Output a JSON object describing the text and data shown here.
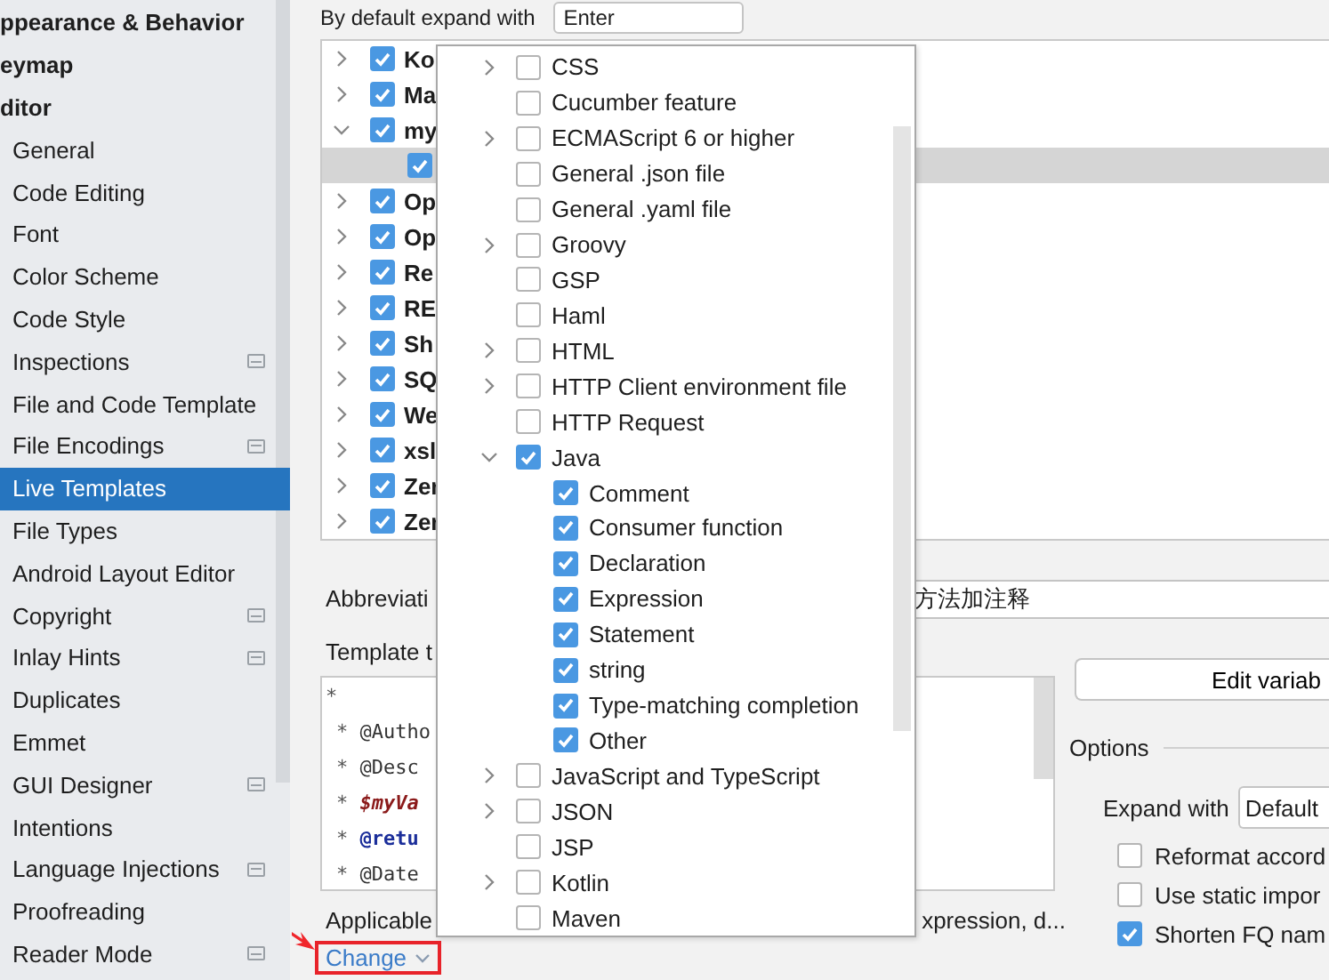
{
  "sidebar": {
    "groups": [
      {
        "label": "ppearance & Behavior"
      },
      {
        "label": "eymap"
      },
      {
        "label": "ditor"
      }
    ],
    "items": [
      {
        "label": "General",
        "selected": false,
        "has_icon": false
      },
      {
        "label": "Code Editing",
        "selected": false,
        "has_icon": false
      },
      {
        "label": "Font",
        "selected": false,
        "has_icon": false
      },
      {
        "label": "Color Scheme",
        "selected": false,
        "has_icon": false
      },
      {
        "label": "Code Style",
        "selected": false,
        "has_icon": false
      },
      {
        "label": "Inspections",
        "selected": false,
        "has_icon": true
      },
      {
        "label": "File and Code Template",
        "selected": false,
        "has_icon": false
      },
      {
        "label": "File Encodings",
        "selected": false,
        "has_icon": true
      },
      {
        "label": "Live Templates",
        "selected": true,
        "has_icon": false
      },
      {
        "label": "File Types",
        "selected": false,
        "has_icon": false
      },
      {
        "label": "Android Layout Editor",
        "selected": false,
        "has_icon": false
      },
      {
        "label": "Copyright",
        "selected": false,
        "has_icon": true
      },
      {
        "label": "Inlay Hints",
        "selected": false,
        "has_icon": true
      },
      {
        "label": "Duplicates",
        "selected": false,
        "has_icon": false
      },
      {
        "label": "Emmet",
        "selected": false,
        "has_icon": false
      },
      {
        "label": "GUI Designer",
        "selected": false,
        "has_icon": true
      },
      {
        "label": "Intentions",
        "selected": false,
        "has_icon": false
      },
      {
        "label": "Language Injections",
        "selected": false,
        "has_icon": true
      },
      {
        "label": "Proofreading",
        "selected": false,
        "has_icon": false
      },
      {
        "label": "Reader Mode",
        "selected": false,
        "has_icon": true
      }
    ]
  },
  "expand_default": {
    "label": "By default expand with",
    "value": "Enter"
  },
  "template_groups": [
    {
      "name": "Ko",
      "checked": true,
      "expanded": false,
      "selected": false
    },
    {
      "name": "Ma",
      "checked": true,
      "expanded": false,
      "selected": false
    },
    {
      "name": "my",
      "checked": true,
      "expanded": true,
      "selected": false,
      "children": [
        {
          "checked": true,
          "selected": true
        }
      ]
    },
    {
      "name": "Op",
      "checked": true,
      "expanded": false,
      "selected": false
    },
    {
      "name": "Op",
      "checked": true,
      "expanded": false,
      "selected": false
    },
    {
      "name": "Re",
      "checked": true,
      "expanded": false,
      "selected": false
    },
    {
      "name": "RE",
      "checked": true,
      "expanded": false,
      "selected": false
    },
    {
      "name": "Sh",
      "checked": true,
      "expanded": false,
      "selected": false
    },
    {
      "name": "SQ",
      "checked": true,
      "expanded": false,
      "selected": false
    },
    {
      "name": "We",
      "checked": true,
      "expanded": false,
      "selected": false
    },
    {
      "name": "xsl",
      "checked": true,
      "expanded": false,
      "selected": false
    },
    {
      "name": "Zer",
      "checked": true,
      "expanded": false,
      "selected": false
    },
    {
      "name": "Zer",
      "checked": true,
      "expanded": false,
      "selected": false
    }
  ],
  "abbreviation": {
    "label": "Abbreviati",
    "value": "方法加注释"
  },
  "template_text": {
    "label": "Template t",
    "lines": [
      {
        "prefix": "*",
        "kind": "plain"
      },
      {
        "prefix": "*",
        "text": "@Autho",
        "kind": "plain"
      },
      {
        "prefix": "*",
        "text": "@Desc",
        "kind": "plain"
      },
      {
        "prefix": "*",
        "text": "$myVa",
        "kind": "variable"
      },
      {
        "prefix": "*",
        "text": "@retu",
        "kind": "keyword"
      },
      {
        "prefix": "*",
        "text": "@Date",
        "kind": "plain"
      }
    ]
  },
  "applicable": {
    "label": "Applicable",
    "contexts": "xpression, d...",
    "change_link": "Change"
  },
  "edit_variables_button": "Edit variab",
  "options": {
    "title": "Options",
    "expand_with": {
      "label": "Expand with",
      "value": "Default"
    },
    "checkboxes": [
      {
        "label": "Reformat accord",
        "checked": false
      },
      {
        "label": "Use static impor",
        "checked": false
      },
      {
        "label": "Shorten FQ nam",
        "checked": true
      }
    ]
  },
  "context_popup": {
    "items": [
      {
        "name": "CSS",
        "checked": false,
        "expandable": true,
        "expanded": false
      },
      {
        "name": "Cucumber feature",
        "checked": false,
        "expandable": false
      },
      {
        "name": "ECMAScript 6 or higher",
        "checked": false,
        "expandable": true,
        "expanded": false
      },
      {
        "name": "General .json file",
        "checked": false,
        "expandable": false
      },
      {
        "name": "General .yaml file",
        "checked": false,
        "expandable": false
      },
      {
        "name": "Groovy",
        "checked": false,
        "expandable": true,
        "expanded": false
      },
      {
        "name": "GSP",
        "checked": false,
        "expandable": false
      },
      {
        "name": "Haml",
        "checked": false,
        "expandable": false
      },
      {
        "name": "HTML",
        "checked": false,
        "expandable": true,
        "expanded": false
      },
      {
        "name": "HTTP Client environment file",
        "checked": false,
        "expandable": true,
        "expanded": false
      },
      {
        "name": "HTTP Request",
        "checked": false,
        "expandable": false
      },
      {
        "name": "Java",
        "checked": true,
        "expandable": true,
        "expanded": true,
        "children": [
          {
            "name": "Comment",
            "checked": true
          },
          {
            "name": "Consumer function",
            "checked": true
          },
          {
            "name": "Declaration",
            "checked": true
          },
          {
            "name": "Expression",
            "checked": true
          },
          {
            "name": "Statement",
            "checked": true
          },
          {
            "name": "string",
            "checked": true
          },
          {
            "name": "Type-matching completion",
            "checked": true
          },
          {
            "name": "Other",
            "checked": true
          }
        ]
      },
      {
        "name": "JavaScript and TypeScript",
        "checked": false,
        "expandable": true,
        "expanded": false
      },
      {
        "name": "JSON",
        "checked": false,
        "expandable": true,
        "expanded": false
      },
      {
        "name": "JSP",
        "checked": false,
        "expandable": false
      },
      {
        "name": "Kotlin",
        "checked": false,
        "expandable": true,
        "expanded": false
      },
      {
        "name": "Maven",
        "checked": false,
        "expandable": false
      }
    ]
  }
}
